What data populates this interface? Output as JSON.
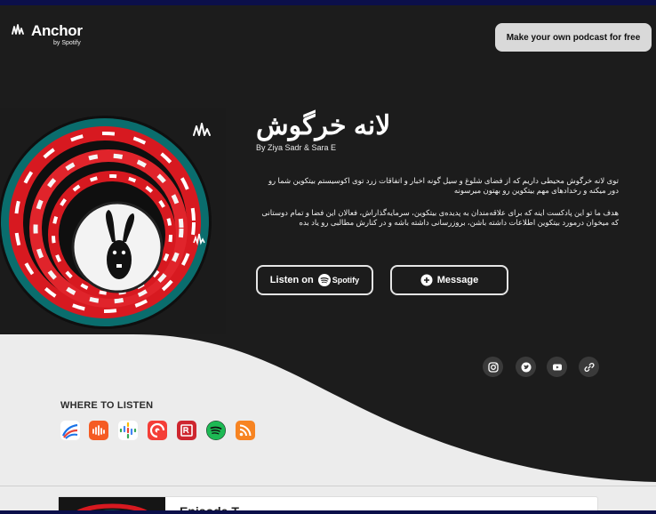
{
  "brand": {
    "name": "Anchor",
    "sub": "by Spotify"
  },
  "header": {
    "cta_label": "Make your own podcast for free"
  },
  "podcast": {
    "title": "لانه خرگوش",
    "authors": "By Ziya Sadr & Sara E",
    "description": [
      "توی لانه خرگوش محیطی داریم که از فضای شلوغ و سیل گونه اخبار و اتفاقات زرد توی اکوسیستم بیتکوین شما رو دور میکنه و رخدادهای مهم بیتکوین رو بهتون میرسونه",
      "هدف ما تو این پادکست اینه که برای علاقه‌مندان به پدیده‌ی بیتکوین، سرمایه‌گذاراش، فعالان این فضا و تمام دوستانی که میخوان درمورد بیتکوین اطلاعات داشته باشن، بروزرسانی داشته باشه و در کنارش مطالبی رو یاد بده"
    ]
  },
  "actions": {
    "listen_prefix": "Listen on",
    "listen_service": "Spotify",
    "message_label": "Message"
  },
  "social": [
    "instagram-icon",
    "twitter-icon",
    "youtube-icon",
    "link-icon"
  ],
  "where_to_listen": {
    "heading": "WHERE TO LISTEN",
    "platforms": [
      "anchor",
      "castbox",
      "google-podcasts",
      "pocket-casts",
      "radiopublic",
      "spotify",
      "rss"
    ]
  },
  "episode": {
    "title_partial": "Episode T..."
  },
  "colors": {
    "hero_bg": "#1c1c1c",
    "page_bg": "#ececec",
    "spotify_green": "#1db954",
    "castbox_orange": "#f55b23",
    "pocketcasts_red": "#f43e37",
    "radiopublic_red": "#ce262f",
    "rss_orange": "#f78422"
  }
}
